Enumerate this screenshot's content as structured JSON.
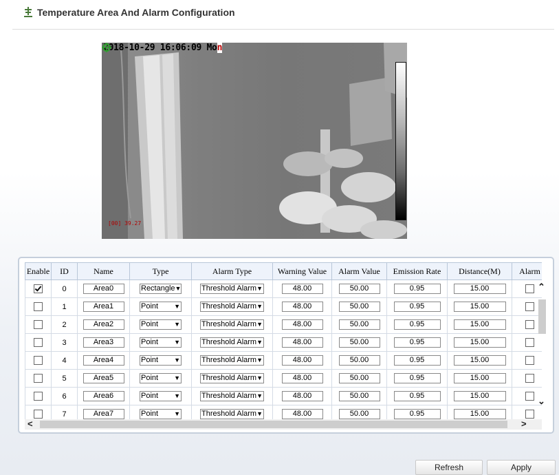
{
  "header": {
    "title": "Temperature Area And Alarm Configuration",
    "icon": "thermometer-icon"
  },
  "video": {
    "timestamp": "2018-10-29 16:06:09 Mo",
    "timestamp_cursor": "n",
    "spot_label": "[00] 39.27"
  },
  "table": {
    "columns": [
      "Enable",
      "ID",
      "Name",
      "Type",
      "Alarm Type",
      "Warning Value",
      "Alarm Value",
      "Emission Rate",
      "Distance(M)",
      "Alarm"
    ],
    "rows": [
      {
        "enable": true,
        "id": "0",
        "name": "Area0",
        "type": "Rectangle",
        "alarm_type": "Threshold Alarm",
        "warning": "48.00",
        "alarm": "50.00",
        "emission": "0.95",
        "distance": "15.00"
      },
      {
        "enable": false,
        "id": "1",
        "name": "Area1",
        "type": "Point",
        "alarm_type": "Threshold Alarm",
        "warning": "48.00",
        "alarm": "50.00",
        "emission": "0.95",
        "distance": "15.00"
      },
      {
        "enable": false,
        "id": "2",
        "name": "Area2",
        "type": "Point",
        "alarm_type": "Threshold Alarm",
        "warning": "48.00",
        "alarm": "50.00",
        "emission": "0.95",
        "distance": "15.00"
      },
      {
        "enable": false,
        "id": "3",
        "name": "Area3",
        "type": "Point",
        "alarm_type": "Threshold Alarm",
        "warning": "48.00",
        "alarm": "50.00",
        "emission": "0.95",
        "distance": "15.00"
      },
      {
        "enable": false,
        "id": "4",
        "name": "Area4",
        "type": "Point",
        "alarm_type": "Threshold Alarm",
        "warning": "48.00",
        "alarm": "50.00",
        "emission": "0.95",
        "distance": "15.00"
      },
      {
        "enable": false,
        "id": "5",
        "name": "Area5",
        "type": "Point",
        "alarm_type": "Threshold Alarm",
        "warning": "48.00",
        "alarm": "50.00",
        "emission": "0.95",
        "distance": "15.00"
      },
      {
        "enable": false,
        "id": "6",
        "name": "Area6",
        "type": "Point",
        "alarm_type": "Threshold Alarm",
        "warning": "48.00",
        "alarm": "50.00",
        "emission": "0.95",
        "distance": "15.00"
      },
      {
        "enable": false,
        "id": "7",
        "name": "Area7",
        "type": "Point",
        "alarm_type": "Threshold Alarm",
        "warning": "48.00",
        "alarm": "50.00",
        "emission": "0.95",
        "distance": "15.00"
      }
    ]
  },
  "buttons": {
    "refresh": "Refresh",
    "apply": "Apply"
  }
}
